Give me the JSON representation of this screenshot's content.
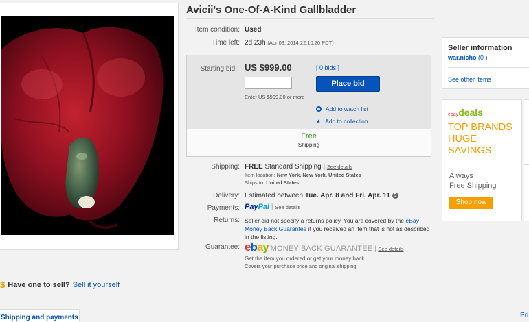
{
  "listing": {
    "title": "Avicii's One-Of-A-Kind Gallbladder"
  },
  "details": {
    "condition_label": "Item condition:",
    "condition_value": "Used",
    "time_left_label": "Time left:",
    "time_left_value": "2d 23h",
    "time_left_date": "(Apr 03, 2014   22:10:20 PDT)"
  },
  "bid": {
    "starting_label": "Starting bid:",
    "price": "US $999.00",
    "bids_link": "[ 0 bids ]",
    "input_value": "",
    "button_label": "Place bid",
    "enter_note": "Enter US $999.00 or more",
    "watch_label": "Add to watch list",
    "collection_label": "Add to collection",
    "shipping_free": "Free",
    "shipping_word": "Shipping"
  },
  "shipping": {
    "label": "Shipping:",
    "free": "FREE",
    "method": "Standard Shipping |",
    "see_details": "See details",
    "location_label": "Item location:",
    "location_value": "New York, New York, United States",
    "ships_to_label": "Ships to:",
    "ships_to_value": "United States"
  },
  "delivery": {
    "label": "Delivery:",
    "prefix": "Estimated between",
    "dates": "Tue. Apr. 8 and Fri. Apr. 11"
  },
  "payments": {
    "label": "Payments:",
    "paypal_pay": "Pay",
    "paypal_pal": "Pal",
    "see_details": "See details"
  },
  "returns": {
    "label": "Returns:",
    "line1": "Seller did not specify a returns policy. You are covered by the",
    "link": "eBay Money Back Guarantee",
    "line2": "if you received an item that is not",
    "line3": "as described in the listing."
  },
  "guarantee": {
    "label": "Guarantee:",
    "logo_e": "e",
    "logo_b": "b",
    "logo_a": "a",
    "logo_y": "y",
    "mbg_text": "MONEY BACK GUARANTEE",
    "see_details": "See details",
    "line1": "Get the item you ordered or get your money back.",
    "line2": "Covers your purchase price and original shipping."
  },
  "seller": {
    "title": "Seller information",
    "name": "war.nicho",
    "score": "(0 )",
    "other_items": "See other items"
  },
  "ad": {
    "logo_small": "ebay",
    "logo_word": "deals",
    "line1": "TOP BRANDS",
    "line2": "HUGE",
    "line3": "SAVINGS",
    "free1": "Always",
    "free2": "Free Shipping",
    "shop_now": "Shop now"
  },
  "sell": {
    "dollar": "$",
    "question": "Have one to sell?",
    "link": "Sell it yourself"
  },
  "tabs": {
    "shipping_payments": "Shipping and payments",
    "pri": "Pri"
  },
  "colors": {
    "ebay_blue": "#0654ba",
    "free_green": "#199900",
    "deals_orange": "#f5a000",
    "deals_green": "#86b817"
  }
}
